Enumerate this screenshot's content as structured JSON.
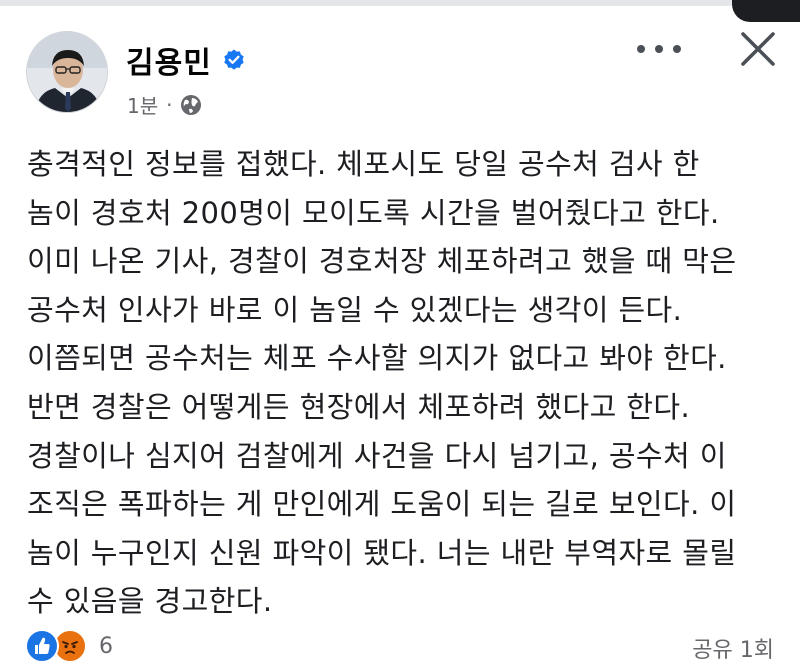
{
  "post": {
    "author": "김용민",
    "time": "1분",
    "separator": "·",
    "audience_icon": "globe-icon",
    "lines": [
      "충격적인 정보를 접했다. 체포시도 당일 공수처 검사 한",
      "놈이 경호처 200명이 모이도록 시간을 벌어줬다고 한다.",
      "이미 나온 기사, 경찰이 경호처장 체포하려고 했을 때 막은",
      "공수처 인사가 바로 이 놈일 수 있겠다는 생각이 든다.",
      "이쯤되면 공수처는 체포 수사할 의지가 없다고 봐야 한다.",
      "반면 경찰은 어떻게든 현장에서 체포하려 했다고 한다.",
      "경찰이나 심지어 검찰에게 사건을 다시 넘기고, 공수처 이",
      "조직은 폭파하는 게 만인에게 도움이 되는 길로 보인다. 이",
      "놈이 누구인지 신원 파악이 됐다. 너는 내란 부역자로 몰릴",
      "수 있음을 경고한다."
    ]
  },
  "reactions": {
    "icons": [
      "like-icon",
      "angry-icon"
    ],
    "count": "6"
  },
  "shares": "공유 1회",
  "colors": {
    "like": "#1b74e4",
    "angry": "#e9710f",
    "verified": "#1877f2",
    "meta_text": "#65676b"
  }
}
